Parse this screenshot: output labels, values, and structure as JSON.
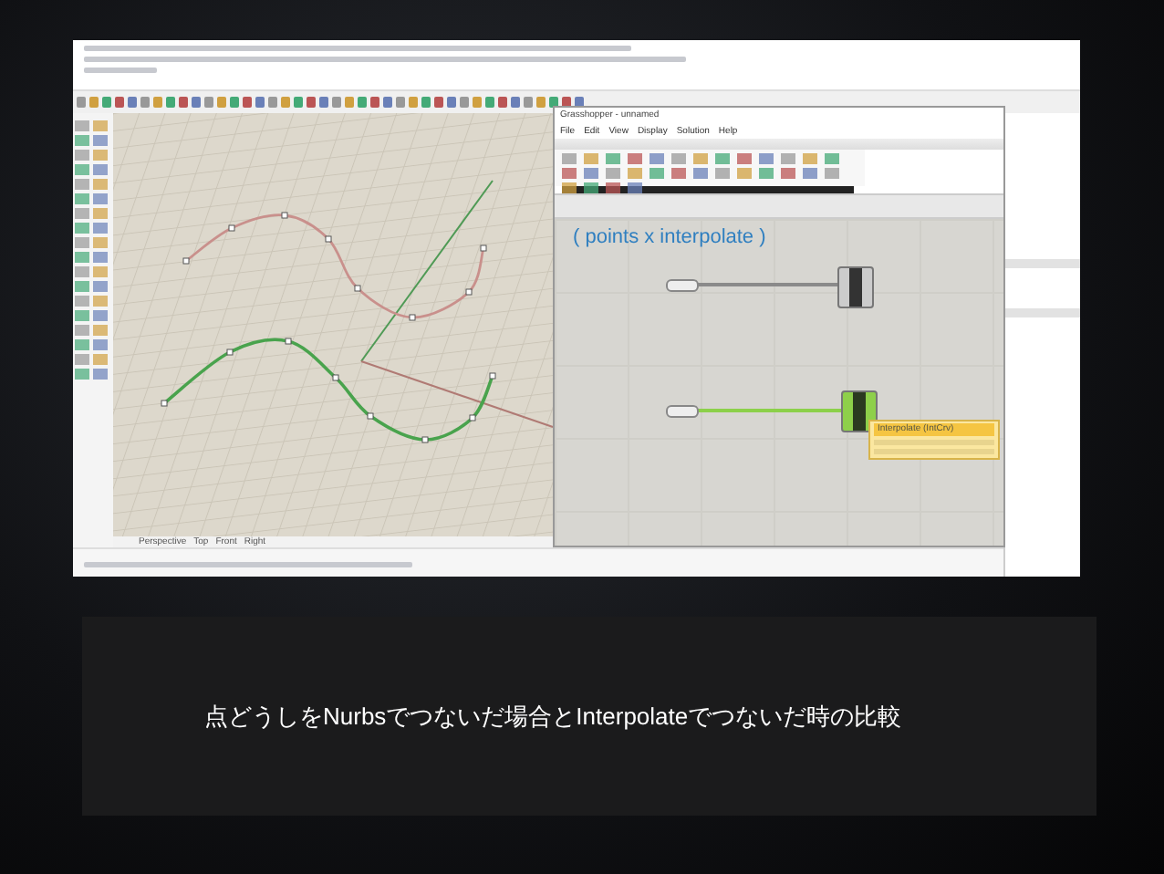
{
  "slide": {
    "screenshot": {
      "viewport": {
        "tabs": [
          "Perspective",
          "Top",
          "Front",
          "Right"
        ]
      },
      "grasshopper": {
        "title": "Grasshopper - unnamed",
        "menu": [
          "File",
          "Edit",
          "View",
          "Display",
          "Solution",
          "Help"
        ],
        "annotation": "( points x interpolate )",
        "tooltip_title": "Interpolate (IntCrv)"
      }
    },
    "caption": "点どうしをNurbsでつないだ場合とInterpolateでつないだ時の比較"
  }
}
